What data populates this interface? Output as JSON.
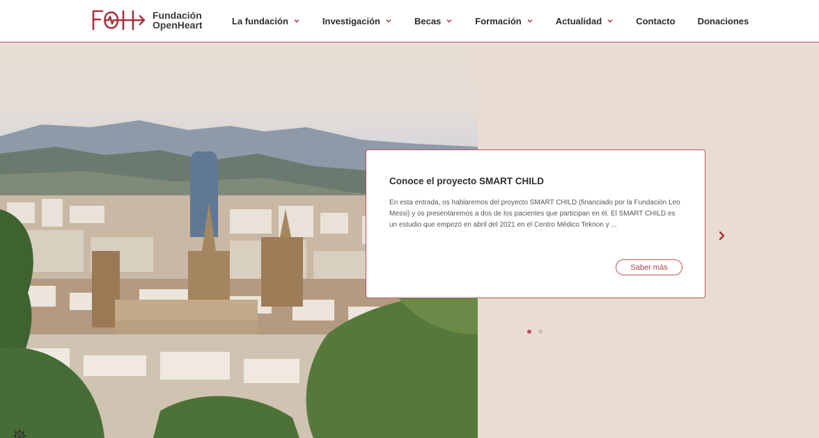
{
  "logo": {
    "mark": "FOH",
    "line1": "Fundación",
    "line2": "OpenHeart"
  },
  "nav": {
    "items": [
      {
        "label": "La fundación",
        "has_dropdown": true
      },
      {
        "label": "Investigación",
        "has_dropdown": true
      },
      {
        "label": "Becas",
        "has_dropdown": true
      },
      {
        "label": "Formación",
        "has_dropdown": true
      },
      {
        "label": "Actualidad",
        "has_dropdown": true
      },
      {
        "label": "Contacto",
        "has_dropdown": false
      },
      {
        "label": "Donaciones",
        "has_dropdown": false
      }
    ]
  },
  "slide": {
    "title": "Conoce el proyecto SMART CHILD",
    "text": "En esta entrada, os hablaremos del proyecto SMART CHILD (financiado por la Fundación Leo Messi) y os presentaremos a dos de los pacientes que participan en él. El SMART CHILD es un estudio que empezó en abril del 2021 en el Centro Médico Teknon y ...",
    "button_label": "Saber más"
  },
  "carousel": {
    "slide_count": 2,
    "active_index": 0
  },
  "colors": {
    "accent": "#b9525a",
    "background": "#e9ddd3",
    "text": "#2b2b2b"
  },
  "icons": {
    "next": "chevron-right-icon",
    "dropdown": "chevron-down-icon",
    "settings": "gear-icon"
  }
}
